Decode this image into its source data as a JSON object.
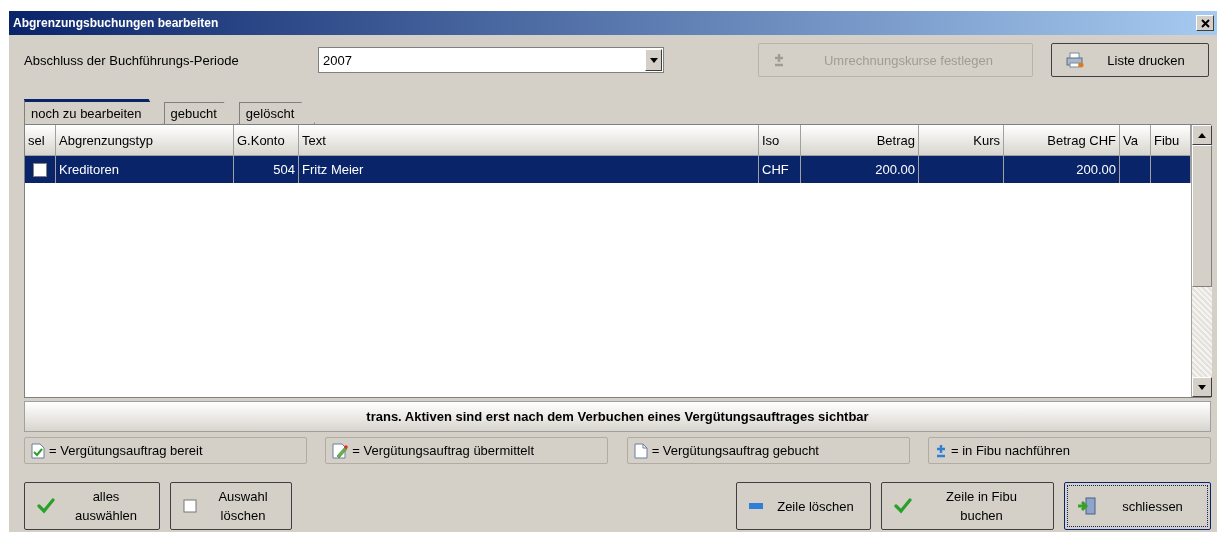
{
  "window": {
    "title": "Abgrenzungsbuchungen bearbeiten"
  },
  "period": {
    "label": "Abschluss der Buchführungs-Periode",
    "value": "2007"
  },
  "top_buttons": [
    {
      "label": "Umrechnungskurse festlegen",
      "kind": "plusminus",
      "disabled": true
    },
    {
      "label": "Liste drucken",
      "kind": "printer",
      "disabled": false
    }
  ],
  "tabs": [
    {
      "label": "noch zu bearbeiten",
      "selected": true
    },
    {
      "label": "gebucht",
      "selected": false
    },
    {
      "label": "gelöscht",
      "selected": false
    }
  ],
  "table": {
    "columns": [
      "sel",
      "Abgrenzungstyp",
      "G.Konto",
      "Text",
      "Iso",
      "Betrag",
      "Kurs",
      "Betrag CHF",
      "Va",
      "Fibu"
    ],
    "rows": [
      {
        "selected": true,
        "checked": false,
        "cells": [
          "",
          "Kreditoren",
          "504",
          "Fritz Meier",
          "CHF",
          "200.00",
          "",
          "200.00",
          "",
          ""
        ]
      }
    ]
  },
  "info": "trans. Aktiven sind erst nach dem Verbuchen eines Vergütungsauftrages sichtbar",
  "legend": [
    {
      "kind": "doc-check",
      "label": "= Vergütungsauftrag bereit"
    },
    {
      "kind": "doc-pen",
      "label": "= Vergütungsauftrag übermittelt"
    },
    {
      "kind": "doc",
      "label": "= Vergütungsauftrag gebucht"
    },
    {
      "kind": "plusminus",
      "label": "= in Fibu nachführen"
    }
  ],
  "left_buttons": [
    {
      "kind": "check",
      "lines": [
        "alles",
        "auswählen"
      ]
    },
    {
      "kind": "box",
      "lines": [
        "Auswahl",
        "löschen"
      ]
    }
  ],
  "right_buttons": [
    {
      "kind": "minus",
      "lines": [
        "Zeile löschen"
      ],
      "focused": false
    },
    {
      "kind": "check",
      "lines": [
        "Zeile in Fibu",
        "buchen"
      ],
      "focused": false
    },
    {
      "kind": "exit",
      "lines": [
        "schliessen"
      ],
      "focused": true
    }
  ]
}
